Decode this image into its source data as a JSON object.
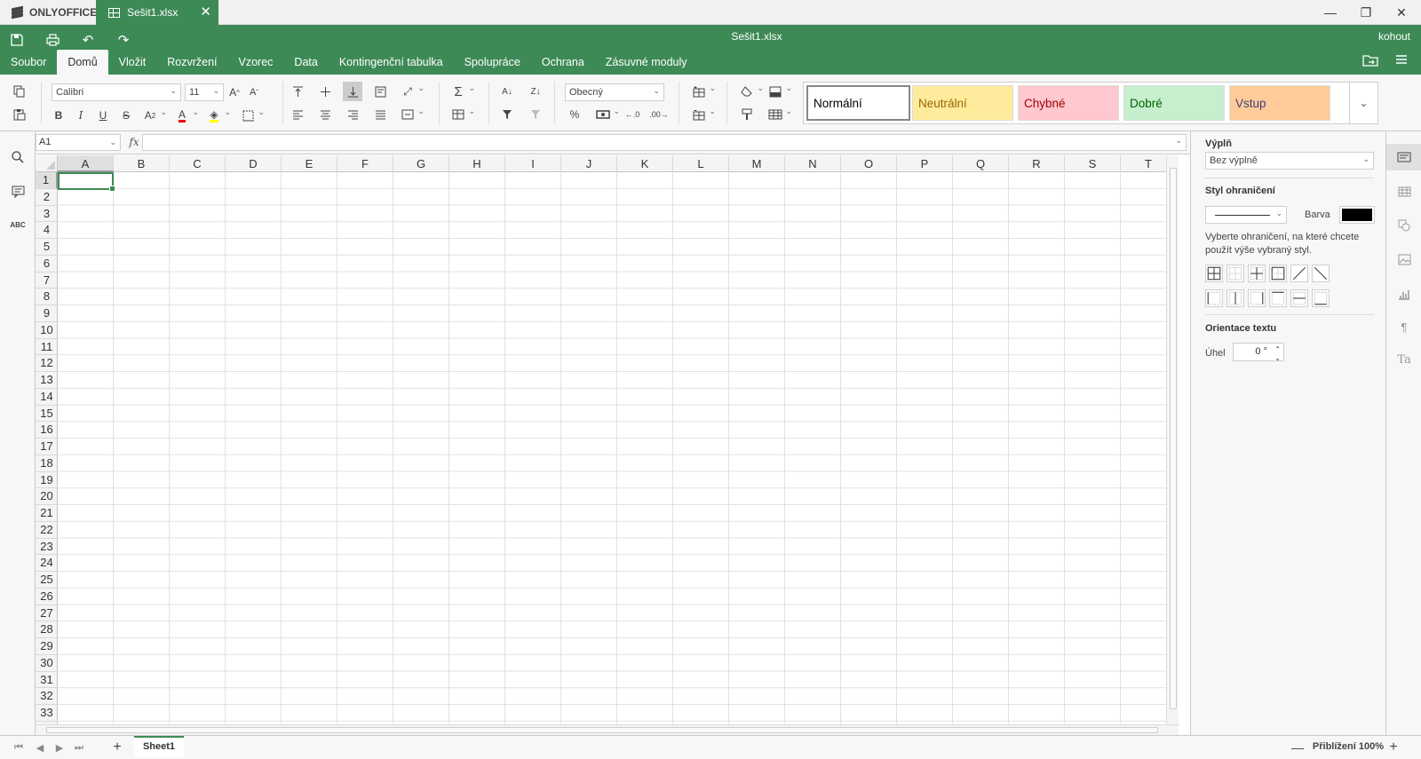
{
  "app": {
    "brand": "ONLYOFFICE",
    "tab_name": "Sešit1.xlsx"
  },
  "header": {
    "title": "Sešit1.xlsx",
    "user": "kohout"
  },
  "menu": [
    "Soubor",
    "Domů",
    "Vložit",
    "Rozvržení",
    "Vzorec",
    "Data",
    "Kontingenční tabulka",
    "Spolupráce",
    "Ochrana",
    "Zásuvné moduly"
  ],
  "menu_active": "Domů",
  "toolbar": {
    "font_name": "Calibri",
    "font_size": "11",
    "number_format": "Obecný",
    "cell_styles": [
      {
        "label": "Normální",
        "bg": "#ffffff",
        "fg": "#000000"
      },
      {
        "label": "Neutrální",
        "bg": "#ffeb9c",
        "fg": "#9c6500"
      },
      {
        "label": "Chybné",
        "bg": "#ffc7ce",
        "fg": "#9c0006"
      },
      {
        "label": "Dobré",
        "bg": "#c6efce",
        "fg": "#006100"
      },
      {
        "label": "Vstup",
        "bg": "#ffcc99",
        "fg": "#3f3f76"
      }
    ]
  },
  "formula_bar": {
    "cell_ref": "A1",
    "fx": "fx",
    "formula": ""
  },
  "grid": {
    "columns": [
      "A",
      "B",
      "C",
      "D",
      "E",
      "F",
      "G",
      "H",
      "I",
      "J",
      "K",
      "L",
      "M",
      "N",
      "O",
      "P",
      "Q",
      "R",
      "S",
      "T"
    ],
    "rows": [
      "1",
      "2",
      "3",
      "4",
      "5",
      "6",
      "7",
      "8",
      "9",
      "10",
      "11",
      "12",
      "13",
      "14",
      "15",
      "16",
      "17",
      "18",
      "19",
      "20",
      "21",
      "22",
      "23",
      "24",
      "25",
      "26",
      "27",
      "28",
      "29",
      "30",
      "31",
      "32",
      "33"
    ],
    "selected": "A1"
  },
  "right_panel": {
    "fill_heading": "Výplň",
    "fill_value": "Bez výplně",
    "border_heading": "Styl ohraničení",
    "color_label": "Barva",
    "border_color": "#000000",
    "border_hint": "Vyberte ohraničení, na které chcete použít výše vybraný styl.",
    "orientation_heading": "Orientace textu",
    "angle_label": "Úhel",
    "angle_value": "0 °"
  },
  "status": {
    "sheet": "Sheet1",
    "zoom": "Přiblížení 100%"
  },
  "colors": {
    "accent": "#3d8a56"
  }
}
